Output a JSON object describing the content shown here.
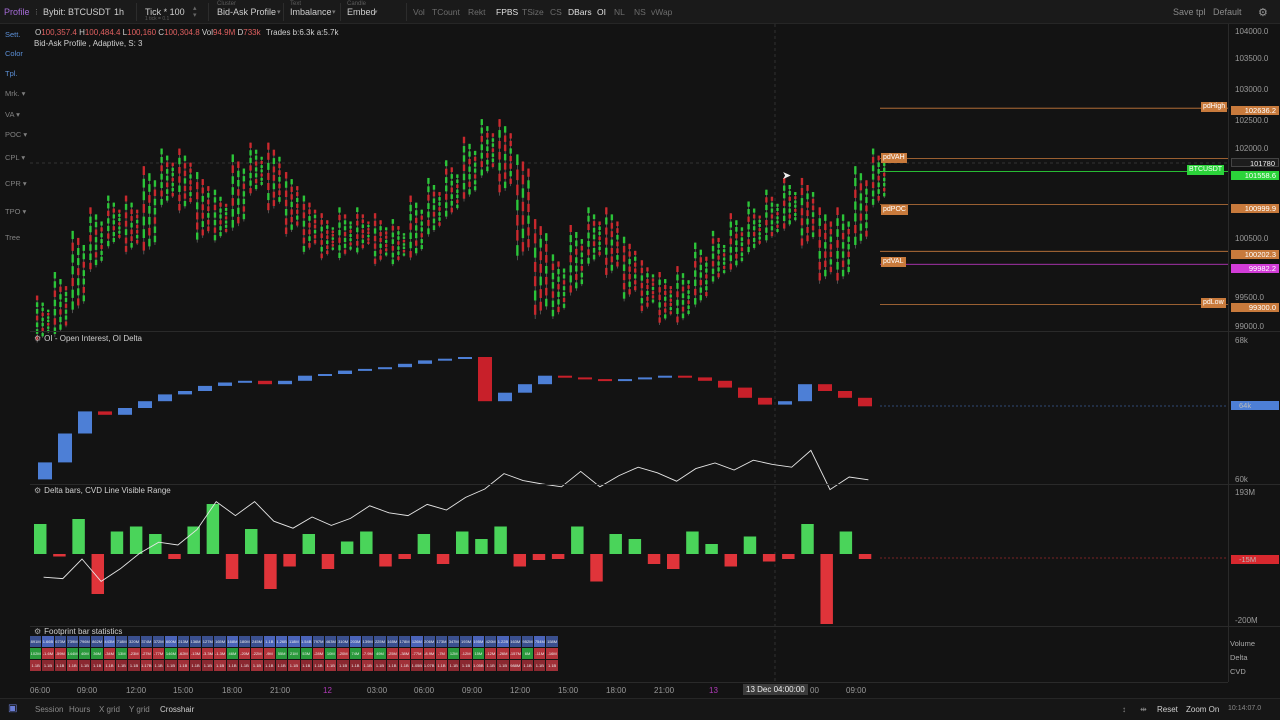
{
  "toolbar": {
    "profile": "Profile",
    "symbol": "Bybit: BTCUSDT",
    "timeframe": "1h",
    "tick_caption": "",
    "tick": "Tick * 100",
    "tick_sub": "1 tick = 0.1",
    "cluster_caption": "Cluster",
    "cluster": "Bid-Ask Profile",
    "text_caption": "Text",
    "text": "Imbalance",
    "candle_caption": "Candle",
    "candle": "Embed",
    "toggles": [
      "Vol",
      "TCount",
      "Rekt",
      "FPBS",
      "TSize",
      "CS",
      "DBars",
      "OI",
      "NL",
      "NS",
      "vWap"
    ],
    "active_toggles": [
      "FPBS",
      "DBars",
      "OI"
    ],
    "save_tpl": "Save tpl",
    "default": "Default"
  },
  "sidebar": [
    "Sett.",
    "Color",
    "Tpl.",
    "Mrk.",
    "VA",
    "POC",
    "CPL",
    "CPR",
    "TPO",
    "Tree"
  ],
  "ohlc": {
    "o_label": "O",
    "o": "100,357.4",
    "h_label": "H",
    "h": "100,484.4",
    "l_label": "L",
    "l": "100,160",
    "c_label": "C",
    "c": "100,304.8",
    "vol_label": "Vol",
    "vol": "94.9M",
    "d_label": "D",
    "d": "733k",
    "trades": "Trades b:6.3k a:5.7k"
  },
  "pane_titles": {
    "price": "Bid-Ask Profile , Adaptive, S: 3",
    "oi": "OI - Open Interest, OI Delta",
    "delta": "Delta bars, CVD Line Visible Range",
    "stats": "Footprint bar statistics"
  },
  "price_axis": [
    "104000.0",
    "103500.0",
    "103000.0",
    "102500.0",
    "102000.0",
    "100500.0",
    "99500.0",
    "99000.0"
  ],
  "price_tags": [
    {
      "label": "pdHigh",
      "value": "102636.2",
      "color": "#c87a3c"
    },
    {
      "label": "pdVAH",
      "value": "101780",
      "color": "#c87a3c"
    },
    {
      "label": "BTCUSDT",
      "value": "101558.6",
      "color": "#2bd43a"
    },
    {
      "label": "pdPOC",
      "value": "100999.9",
      "color": "#c87a3c"
    },
    {
      "label": "pdVAL",
      "value": "100202.3",
      "color": "#c87a3c"
    },
    {
      "label": "",
      "value": "99982.2",
      "color": "#d23cd8"
    },
    {
      "label": "pdLow",
      "value": "99300.0",
      "color": "#c87a3c"
    }
  ],
  "oi_axis": {
    "top": "68k",
    "bottom": "60k",
    "current": "64k"
  },
  "delta_axis": {
    "top": "193M",
    "bottom": "-200M",
    "current": "-15M"
  },
  "stats_labels": [
    "Volume",
    "Delta",
    "CVD"
  ],
  "stats": {
    "volume": [
      "891M",
      "1.66B",
      "673M",
      "739M",
      "796M",
      "862M",
      "443M",
      "718M",
      "320M",
      "374M",
      "372M",
      "600M",
      "213M",
      "136M",
      "127M",
      "165M",
      "168M",
      "180M",
      "245M",
      "1.1B",
      "1.26B",
      "118M",
      "1.54B",
      "797M",
      "463M",
      "310M",
      "203M",
      "139M",
      "225M",
      "165M",
      "178M",
      "126M",
      "206M",
      "173M",
      "347M",
      "193M",
      "195M",
      "420M",
      "1.22B",
      "163M",
      "952M",
      "754M",
      "158M"
    ],
    "delta": [
      "102M",
      "-1.6M",
      "-59M",
      "144M",
      "40M",
      "36M",
      "-34M",
      "13M",
      "-23M",
      "-27M",
      "-77M",
      "146M",
      "-62M",
      "-13M",
      "-3.3M",
      "-1.3M",
      "46M",
      "-20M",
      "-22M",
      "-9M",
      "55M",
      "21M",
      "53M",
      "-28M",
      "10M",
      "-20M",
      "74M",
      "-7.9M",
      "49M",
      "-25M",
      "-38M",
      "-77M",
      "-8.9M",
      "-7M",
      "12M",
      "-12M",
      "15M",
      "-12M",
      "-26M",
      "-157M",
      "6M",
      "-11M",
      "-16M"
    ],
    "cvd": [
      "1.1B",
      "1.1B",
      "1.1B",
      "1.1B",
      "1.1B",
      "1.1B",
      "1.1B",
      "1.1B",
      "1.1B",
      "1.17B",
      "1.1B",
      "1.1B",
      "1.1B",
      "1.1B",
      "1.1B",
      "1.1B",
      "1.1B",
      "1.1B",
      "1.1B",
      "1.1B",
      "1.1B",
      "1.1B",
      "1.1B",
      "1.1B",
      "1.1B",
      "1.1B",
      "1.1B",
      "1.1B",
      "1.1B",
      "1.1B",
      "1.1B",
      "1.05B",
      "1.07B",
      "1.1B",
      "1.1B",
      "1.1B",
      "1.05B",
      "1.1B",
      "1.1B",
      "988M",
      "1.1B",
      "1.1B",
      "1.1B"
    ]
  },
  "time_axis": [
    "06:00",
    "09:00",
    "12:00",
    "15:00",
    "18:00",
    "21:00",
    "12",
    "03:00",
    "06:00",
    "09:00",
    "12:00",
    "15:00",
    "18:00",
    "21:00",
    "13",
    "00",
    "09:00"
  ],
  "crosshair_time": "13 Dec 04:00:00",
  "bottombar": {
    "session": "Session",
    "hours": "Hours",
    "xgrid": "X grid",
    "ygrid": "Y grid",
    "crosshair": "Crosshair",
    "reset": "Reset",
    "zoom_on": "Zoom On",
    "clock": "10:14:07.0"
  },
  "colors": {
    "bull": "#2bd43a",
    "bear": "#d8282e",
    "oi_up": "#4d7fd6",
    "oi_down": "#c8202a",
    "level": "#c87a3c",
    "magenta": "#d23cd8",
    "background": "#131313"
  }
}
